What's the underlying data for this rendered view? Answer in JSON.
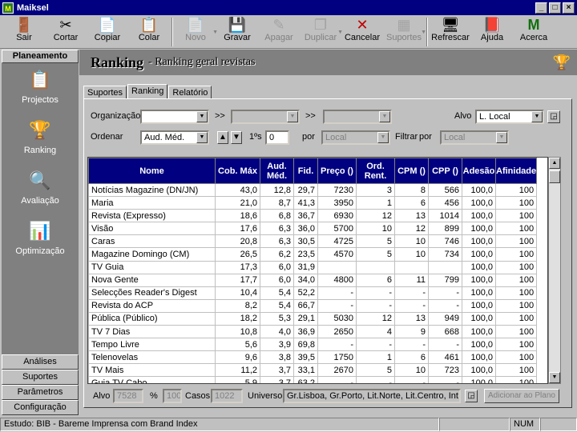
{
  "app": {
    "title": "Maiksel",
    "icon_letter": "M"
  },
  "toolbar": [
    {
      "label": "Sair",
      "icon": "exit-icon",
      "glyph": "🚪",
      "enabled": true
    },
    {
      "label": "Cortar",
      "icon": "scissors-icon",
      "glyph": "✂",
      "enabled": true
    },
    {
      "label": "Copiar",
      "icon": "copy-icon",
      "glyph": "📄",
      "enabled": true
    },
    {
      "label": "Colar",
      "icon": "paste-icon",
      "glyph": "📋",
      "enabled": true
    },
    {
      "label": "Novo",
      "icon": "new-icon",
      "glyph": "📄",
      "enabled": false
    },
    {
      "label": "Gravar",
      "icon": "save-icon",
      "glyph": "💾",
      "enabled": true
    },
    {
      "label": "Apagar",
      "icon": "eraser-icon",
      "glyph": "✎",
      "enabled": false
    },
    {
      "label": "Duplicar",
      "icon": "duplicate-icon",
      "glyph": "❐",
      "enabled": false
    },
    {
      "label": "Cancelar",
      "icon": "cancel-icon",
      "glyph": "✕",
      "enabled": true
    },
    {
      "label": "Suportes",
      "icon": "supports-icon",
      "glyph": "▦",
      "enabled": false
    },
    {
      "label": "Refrescar",
      "icon": "refresh-icon",
      "glyph": "🖥",
      "enabled": true
    },
    {
      "label": "Ajuda",
      "icon": "help-book-icon",
      "glyph": "📕",
      "enabled": true
    },
    {
      "label": "Acerca",
      "icon": "about-icon",
      "glyph": "M",
      "enabled": true
    }
  ],
  "sidebar": {
    "heading": "Planeamento",
    "items": [
      {
        "label": "Projectos",
        "icon": "projects-icon",
        "glyph": "📋"
      },
      {
        "label": "Ranking",
        "icon": "ranking-icon",
        "glyph": "🏆"
      },
      {
        "label": "Avaliação",
        "icon": "evaluation-icon",
        "glyph": "🔍"
      },
      {
        "label": "Optimização",
        "icon": "optimization-icon",
        "glyph": "📊"
      }
    ],
    "bottom": [
      "Análises",
      "Suportes",
      "Parâmetros",
      "Configuração"
    ]
  },
  "header": {
    "title": "Ranking",
    "subtitle": "- Ranking geral revistas"
  },
  "tabs": [
    "Suportes",
    "Ranking",
    "Relatório"
  ],
  "filters": {
    "organizacao_label": "Organização",
    "organizacao_value": "",
    "sep1": ">>",
    "sep2": ">>",
    "alvo_label": "Alvo",
    "alvo_value": "L. Local",
    "ordenar_label": "Ordenar",
    "ordenar_value": "Aud. Méd.",
    "sort_asc": "▲",
    "sort_desc": "▼",
    "top_label": "1ºs",
    "top_value": "0",
    "por_label": "por",
    "por_value": "Local",
    "filtrar_label": "Filtrar",
    "filtrar_por_label": "por",
    "filtrar_value": "Local"
  },
  "table": {
    "columns": [
      "Nome",
      "Cob. Máx",
      "Aud. Méd.",
      "Fid.",
      "Preço ()",
      "Ord. Rent.",
      "CPM ()",
      "CPP ()",
      "Adesão",
      "Afinidade"
    ],
    "rows": [
      [
        "Notícias Magazine (DN/JN)",
        "43,0",
        "12,8",
        "29,7",
        "7230",
        "3",
        "8",
        "566",
        "100,0",
        "100"
      ],
      [
        "Maria",
        "21,0",
        "8,7",
        "41,3",
        "3950",
        "1",
        "6",
        "456",
        "100,0",
        "100"
      ],
      [
        "Revista (Expresso)",
        "18,6",
        "6,8",
        "36,7",
        "6930",
        "12",
        "13",
        "1014",
        "100,0",
        "100"
      ],
      [
        "Visão",
        "17,6",
        "6,3",
        "36,0",
        "5700",
        "10",
        "12",
        "899",
        "100,0",
        "100"
      ],
      [
        "Caras",
        "20,8",
        "6,3",
        "30,5",
        "4725",
        "5",
        "10",
        "746",
        "100,0",
        "100"
      ],
      [
        "Magazine Domingo (CM)",
        "26,5",
        "6,2",
        "23,5",
        "4570",
        "5",
        "10",
        "734",
        "100,0",
        "100"
      ],
      [
        "TV Guia",
        "17,3",
        "6,0",
        "31,9",
        "",
        "",
        "",
        "",
        "100,0",
        "100"
      ],
      [
        "Nova Gente",
        "17,7",
        "6,0",
        "34,0",
        "4800",
        "6",
        "11",
        "799",
        "100,0",
        "100"
      ],
      [
        "Selecções Reader's Digest",
        "10,4",
        "5,4",
        "52,2",
        "-",
        "-",
        "-",
        "-",
        "100,0",
        "100"
      ],
      [
        "Revista do ACP",
        "8,2",
        "5,4",
        "66,7",
        "-",
        "-",
        "-",
        "-",
        "100,0",
        "100"
      ],
      [
        "Pública (Público)",
        "18,2",
        "5,3",
        "29,1",
        "5030",
        "12",
        "13",
        "949",
        "100,0",
        "100"
      ],
      [
        "TV 7 Dias",
        "10,8",
        "4,0",
        "36,9",
        "2650",
        "4",
        "9",
        "668",
        "100,0",
        "100"
      ],
      [
        "Tempo Livre",
        "5,6",
        "3,9",
        "69,8",
        "-",
        "-",
        "-",
        "-",
        "100,0",
        "100"
      ],
      [
        "Telenovelas",
        "9,6",
        "3,8",
        "39,5",
        "1750",
        "1",
        "6",
        "461",
        "100,0",
        "100"
      ],
      [
        "TV Mais",
        "11,2",
        "3,7",
        "33,1",
        "2670",
        "5",
        "10",
        "723",
        "100,0",
        "100"
      ],
      [
        "Guia TV Cabo",
        "5,9",
        "3,7",
        "63,2",
        "-",
        "-",
        "-",
        "-",
        "100,0",
        "100"
      ]
    ]
  },
  "footer": {
    "alvo_label": "Alvo",
    "alvo_value": "7528",
    "pct_label": "%",
    "pct_value": "100",
    "casos_label": "Casos",
    "casos_value": "1022",
    "universo_label": "Universo",
    "universo_value": "Gr.Lisboa, Gr.Porto, Lit.Norte, Lit.Centro, Int.Norte,",
    "add_button": "Adicionar ao Plano"
  },
  "statusbar": {
    "text": "Estudo: BIB - Bareme Imprensa com Brand Index",
    "num": "NUM"
  }
}
